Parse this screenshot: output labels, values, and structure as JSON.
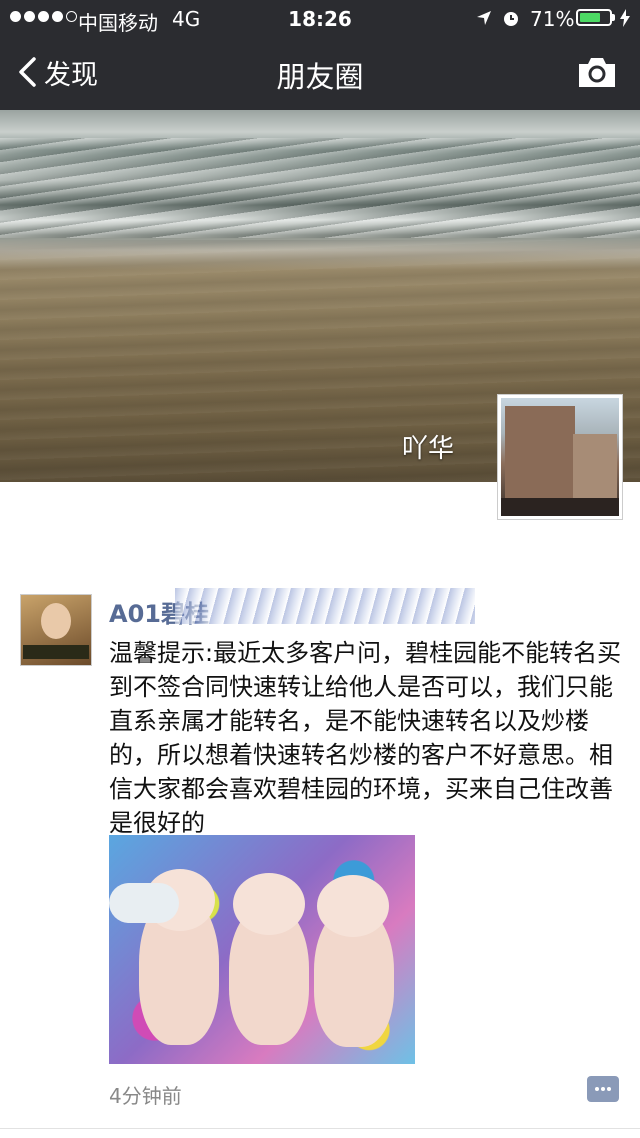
{
  "status_bar": {
    "carrier": "中国移动",
    "network": "4G",
    "time": "18:26",
    "battery_pct": "71%",
    "battery_level": 0.71,
    "battery_color": "#4cd964"
  },
  "nav": {
    "back_label": "发现",
    "title": "朋友圈",
    "camera_icon": "camera-icon"
  },
  "profile": {
    "name": "吖华"
  },
  "post": {
    "author": "A01碧桂",
    "author_color": "#576b95",
    "text": "温馨提示:最近太多客户问，碧桂园能不能转名买到不签合同快速转让给他人是否可以，我们只能直系亲属才能转名，是不能快速转名以及炒楼的，所以想着快速转名炒楼的客户不好意思。相信大家都会喜欢碧桂园的环境，买来自己住改善是很好的",
    "time": "4分钟前"
  }
}
